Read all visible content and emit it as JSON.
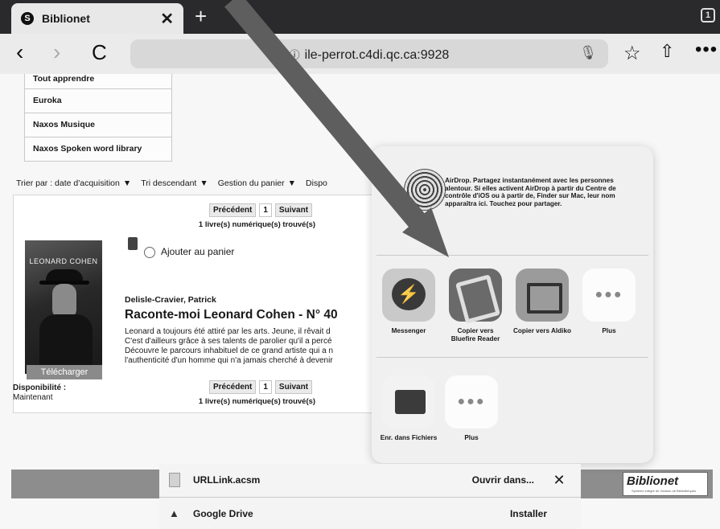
{
  "tab": {
    "favicon": "S",
    "title": "Biblionet",
    "close": "✕"
  },
  "tabbar": {
    "new_tab": "+",
    "tab_count": "1"
  },
  "toolbar": {
    "back": "‹",
    "forward": "›",
    "reload": "C",
    "url": "ile-perrot.c4di.qc.ca:9928",
    "info_icon": "ⓘ",
    "mic_icon": "🎙",
    "star_icon": "☆",
    "share_icon": "⇧",
    "more_icon": "•••"
  },
  "menu": {
    "items": [
      "Tout apprendre",
      "Euroka",
      "Naxos Musique",
      "Naxos Spoken word library"
    ]
  },
  "sort": {
    "sort_by": "Trier par : date d'acquisition",
    "order": "Tri descendant",
    "cart_mgmt": "Gestion du panier",
    "availability": "Dispo",
    "arrow": "▼"
  },
  "pager": {
    "previous": "Précédent",
    "page": "1",
    "next": "Suivant",
    "found": "1 livre(s) numérique(s) trouvé(s)"
  },
  "book": {
    "cover_text": "LEONARD COHEN",
    "download": "Télécharger",
    "add_to_cart": "Ajouter au panier",
    "author": "Delisle-Cravier, Patrick",
    "title": "Raconte-moi Leonard Cohen - N° 40",
    "summary": [
      "Leonard a toujours été attiré par les arts. Jeune, il rêvait d",
      "C'est d'ailleurs grâce à ses talents de parolier qu'il a percé",
      "Découvre le parcours inhabituel de ce grand artiste qui a n",
      "l'authenticité d'un homme qui n'a jamais cherché à devenir"
    ],
    "availability_label": "Disponibilité :",
    "availability_value": "Maintenant"
  },
  "share": {
    "airdrop_text": "AirDrop. Partagez instantanément avec les personnes alentour. Si elles activent AirDrop à partir du Centre de contrôle d'iOS ou à partir de, Finder sur Mac, leur nom apparaîtra ici. Touchez pour partager.",
    "apps": [
      "Messenger",
      "Copier vers Bluefire Reader",
      "Copier vers Aldiko",
      "Plus"
    ],
    "actions": [
      "Enr. dans Fichiers",
      "Plus"
    ],
    "more_dots": "●●●"
  },
  "download_bar": {
    "file_name": "URLLink.acsm",
    "open_in": "Ouvrir dans...",
    "close": "✕",
    "drive_name": "Google Drive",
    "drive_action": "Installer"
  },
  "logo": {
    "text": "Biblionet",
    "subtitle": "Système intégré de Gestion de Bibliothèques"
  },
  "colors": {
    "annotation_arrow": "#5f5f5f",
    "bottom_bar": "#8d8d8d"
  }
}
